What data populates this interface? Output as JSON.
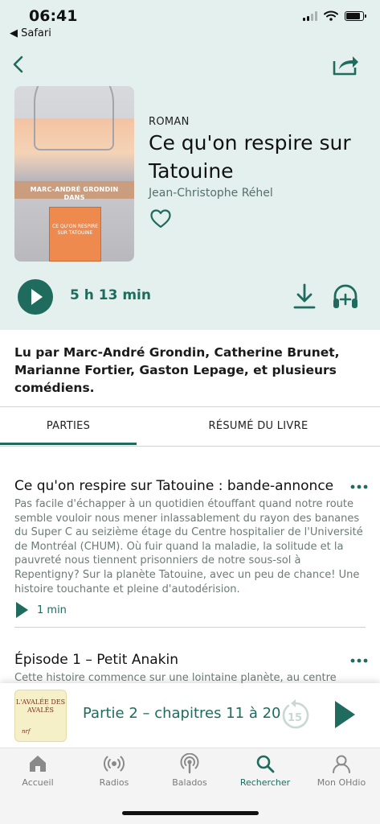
{
  "status": {
    "time": "06:41",
    "back_app": "◀ Safari"
  },
  "book": {
    "genre": "ROMAN",
    "title": "Ce qu'on respire sur Tatouine",
    "author": "Jean-Christophe Réhel",
    "duration": "5 h 13 min",
    "cover_author": "MARC-ANDRÉ GRONDIN",
    "cover_dans": "DANS",
    "cover_title": "CE QU'ON RESPIRE SUR TATOUINE"
  },
  "readers": "Lu par Marc-André Grondin, Catherine Brunet, Marianne Fortier, Gaston Lepage, et plusieurs comédiens.",
  "tabs": {
    "parts": "PARTIES",
    "summary": "RÉSUMÉ DU LIVRE"
  },
  "episodes": [
    {
      "title": "Ce qu'on respire sur Tatouine : bande-annonce",
      "description": "Pas facile d'échapper à un quotidien étouffant quand notre route semble vouloir nous mener inlassablement du rayon des bananes du Super C au seizième étage du Centre hospitalier de l'Université de Montréal (CHUM). Où fuir quand la maladie, la solitude et la pauvreté nous tiennent prisonniers de notre sous-sol à Repentigny? Sur la planète Tatouine, avec un peu de chance! Une histoire touchante et pleine d'autodérision.",
      "length": "1 min"
    },
    {
      "title": "Épisode 1 – Petit Anakin",
      "description": "Cette histoire commence sur une lointaine planète, au centre"
    }
  ],
  "mini_player": {
    "title": "Partie 2 – chapitres 11 à 20",
    "cover_title": "L'AVALÉE DES AVALÉS",
    "cover_publisher": "nrf",
    "replay_seconds": "15"
  },
  "tabbar": {
    "home": "Accueil",
    "radios": "Radios",
    "podcasts": "Balados",
    "search": "Rechercher",
    "account": "Mon OHdio"
  },
  "colors": {
    "accent": "#1f6b5e",
    "header_bg": "#e3f0ee"
  }
}
